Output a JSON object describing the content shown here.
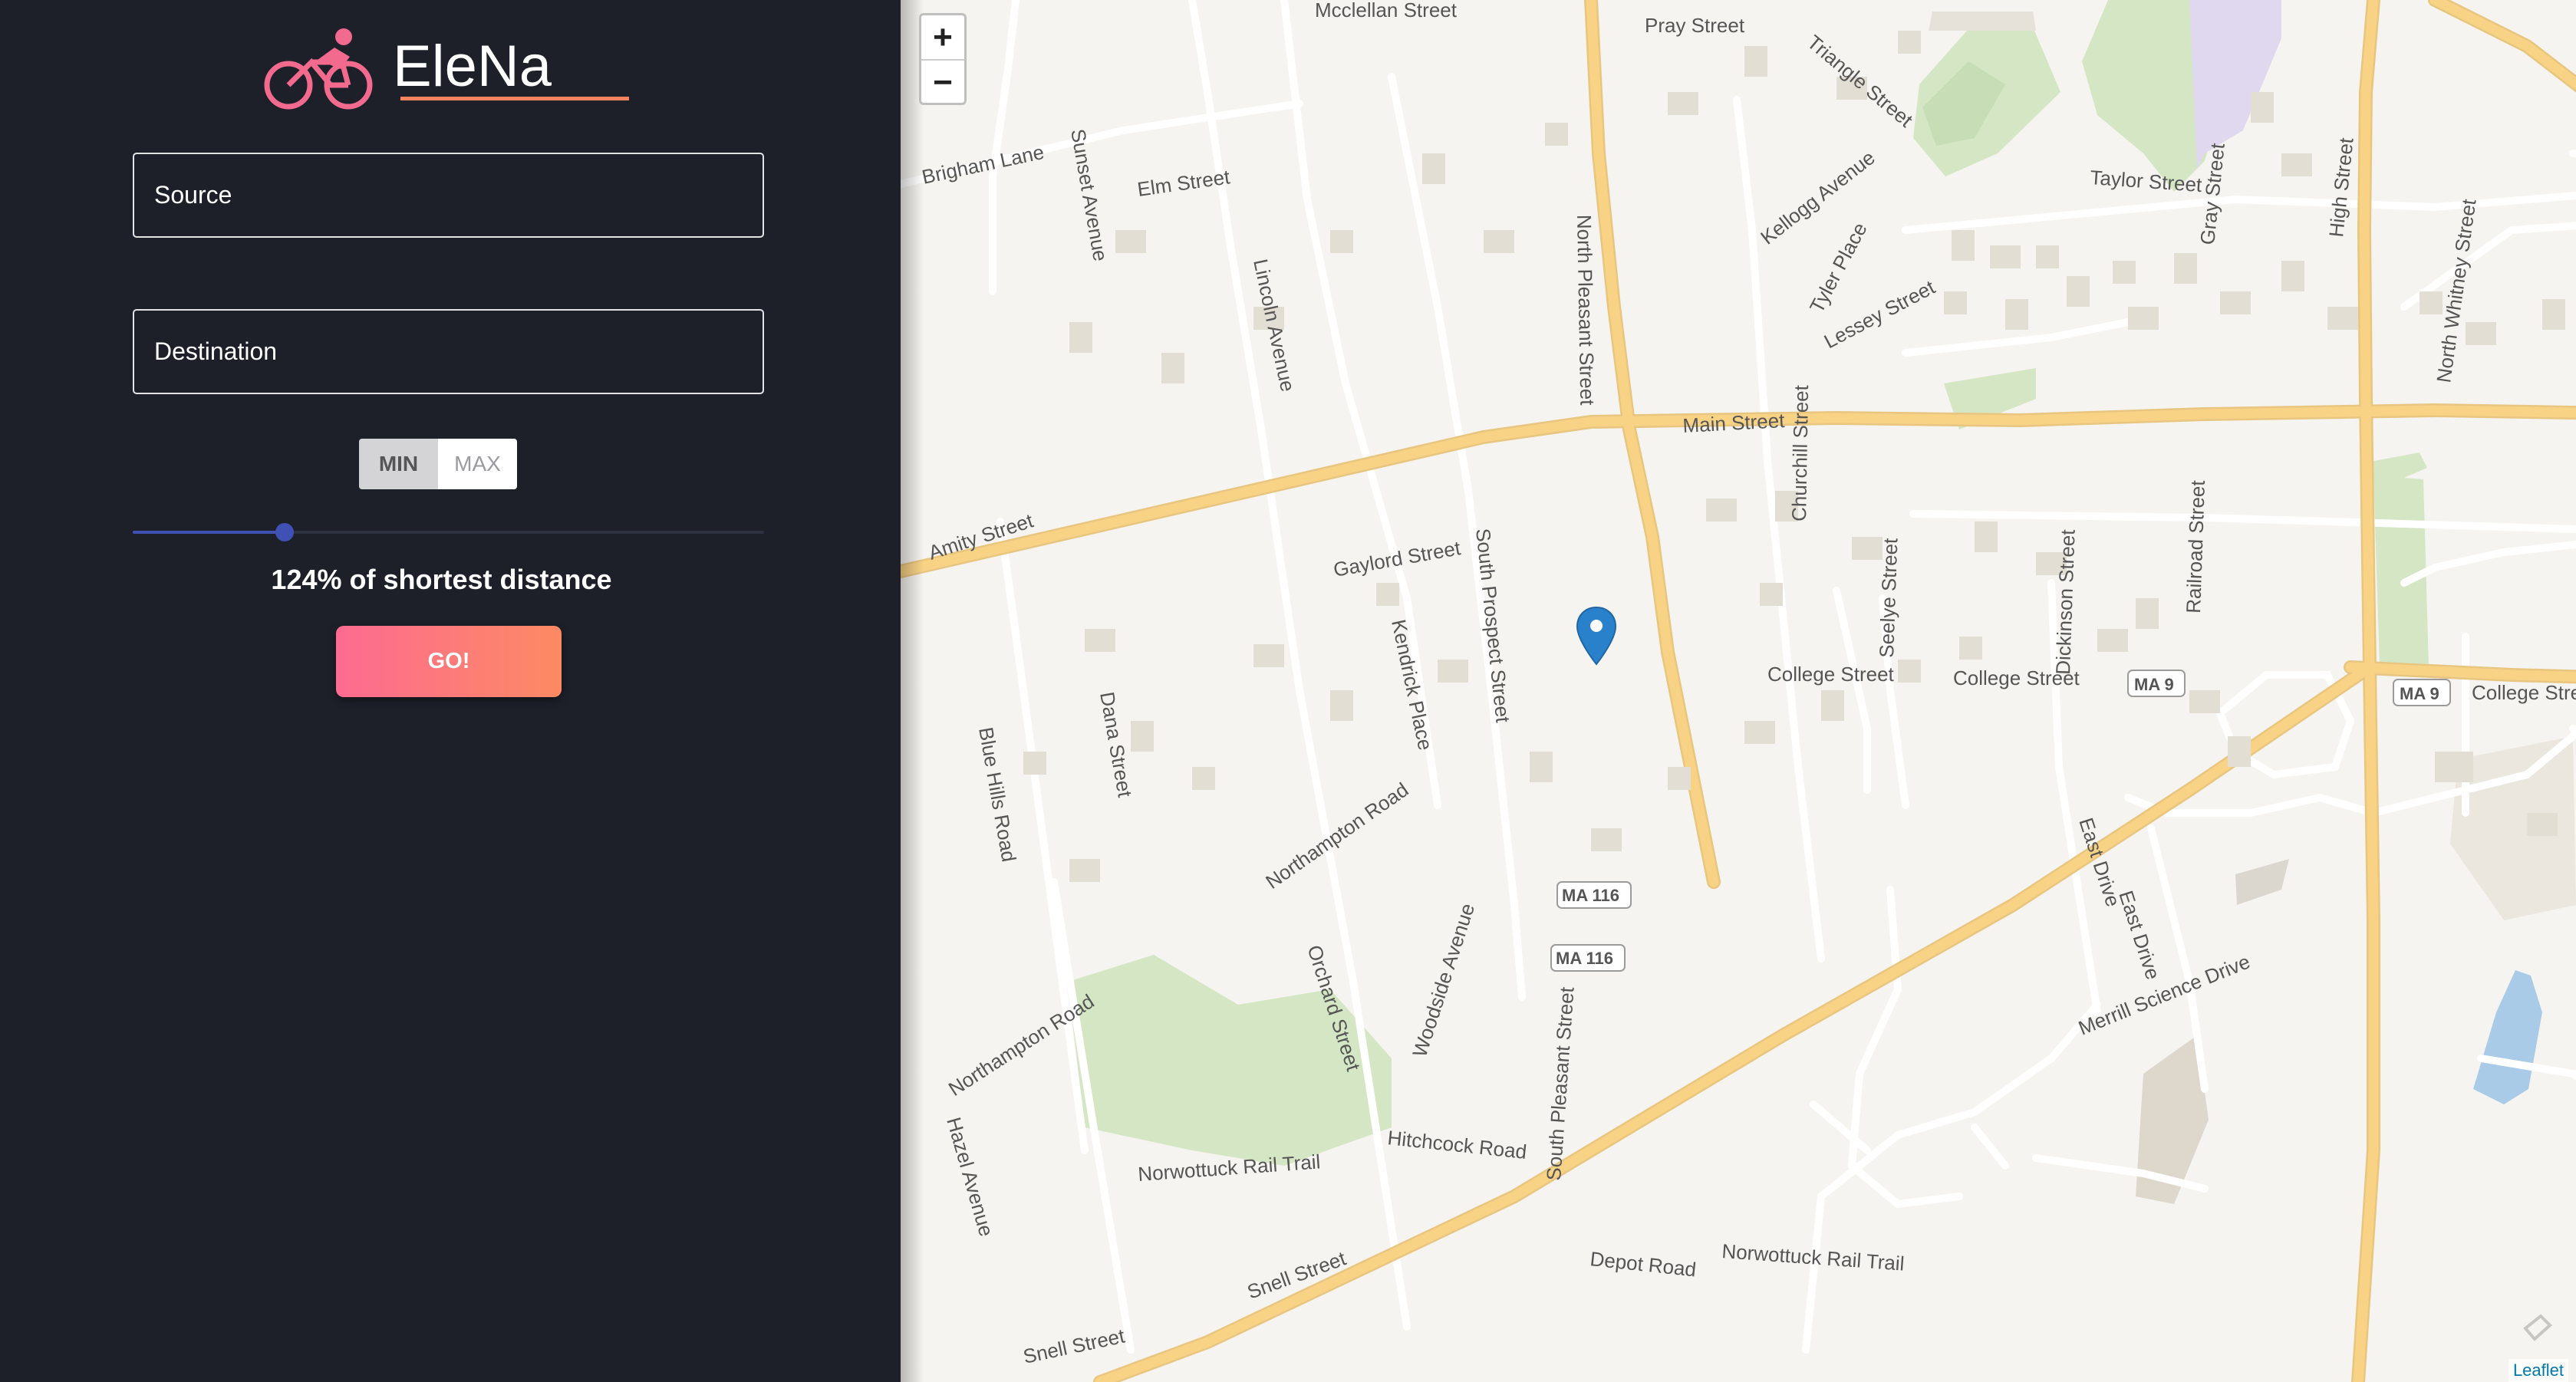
{
  "app": {
    "name": "EleNa"
  },
  "form": {
    "source_placeholder": "Source",
    "destination_placeholder": "Destination",
    "toggle": {
      "min_label": "MIN",
      "max_label": "MAX",
      "selected": "MIN"
    },
    "slider_value_fraction": 0.24,
    "percentage_text": "124% of shortest distance",
    "go_label": "GO!"
  },
  "map": {
    "zoom_in_label": "+",
    "zoom_out_label": "−",
    "attribution": "Leaflet",
    "street_labels": [
      "Mcclellan Street",
      "Pray Street",
      "Triangle Street",
      "Brigham Lane",
      "Sunset Avenue",
      "Elm Street",
      "Lincoln Avenue",
      "North Pleasant Street",
      "Kellogg Avenue",
      "Tyler Place",
      "Lessey Street",
      "Taylor Street",
      "Gray Street",
      "High Street",
      "North Whitney Street",
      "Main Street",
      "Amity Street",
      "Churchill Street",
      "Gaylord Street",
      "South Prospect Street",
      "Kendrick Place",
      "Seelye Street",
      "Dickinson Street",
      "Railroad Street",
      "College Street",
      "MA 9",
      "Blue Hills Road",
      "Dana Street",
      "Northampton Road",
      "MA 116",
      "Orchard Street",
      "Woodside Avenue",
      "Merrill Science Drive",
      "East Drive",
      "Hitchcock Road",
      "Norwottuck Rail Trail",
      "South Pleasant Street",
      "Hazel Avenue",
      "Depot Road",
      "Snell Street"
    ]
  },
  "colors": {
    "sidebar_bg": "#1d2029",
    "accent_pink": "#fd6b91",
    "accent_orange": "#fd8a63",
    "slider_blue": "#3f51b5",
    "map_bg": "#f6f4f0",
    "major_road": "#f8d386",
    "park": "#d4e6c4",
    "marker_blue": "#2a81cb"
  }
}
